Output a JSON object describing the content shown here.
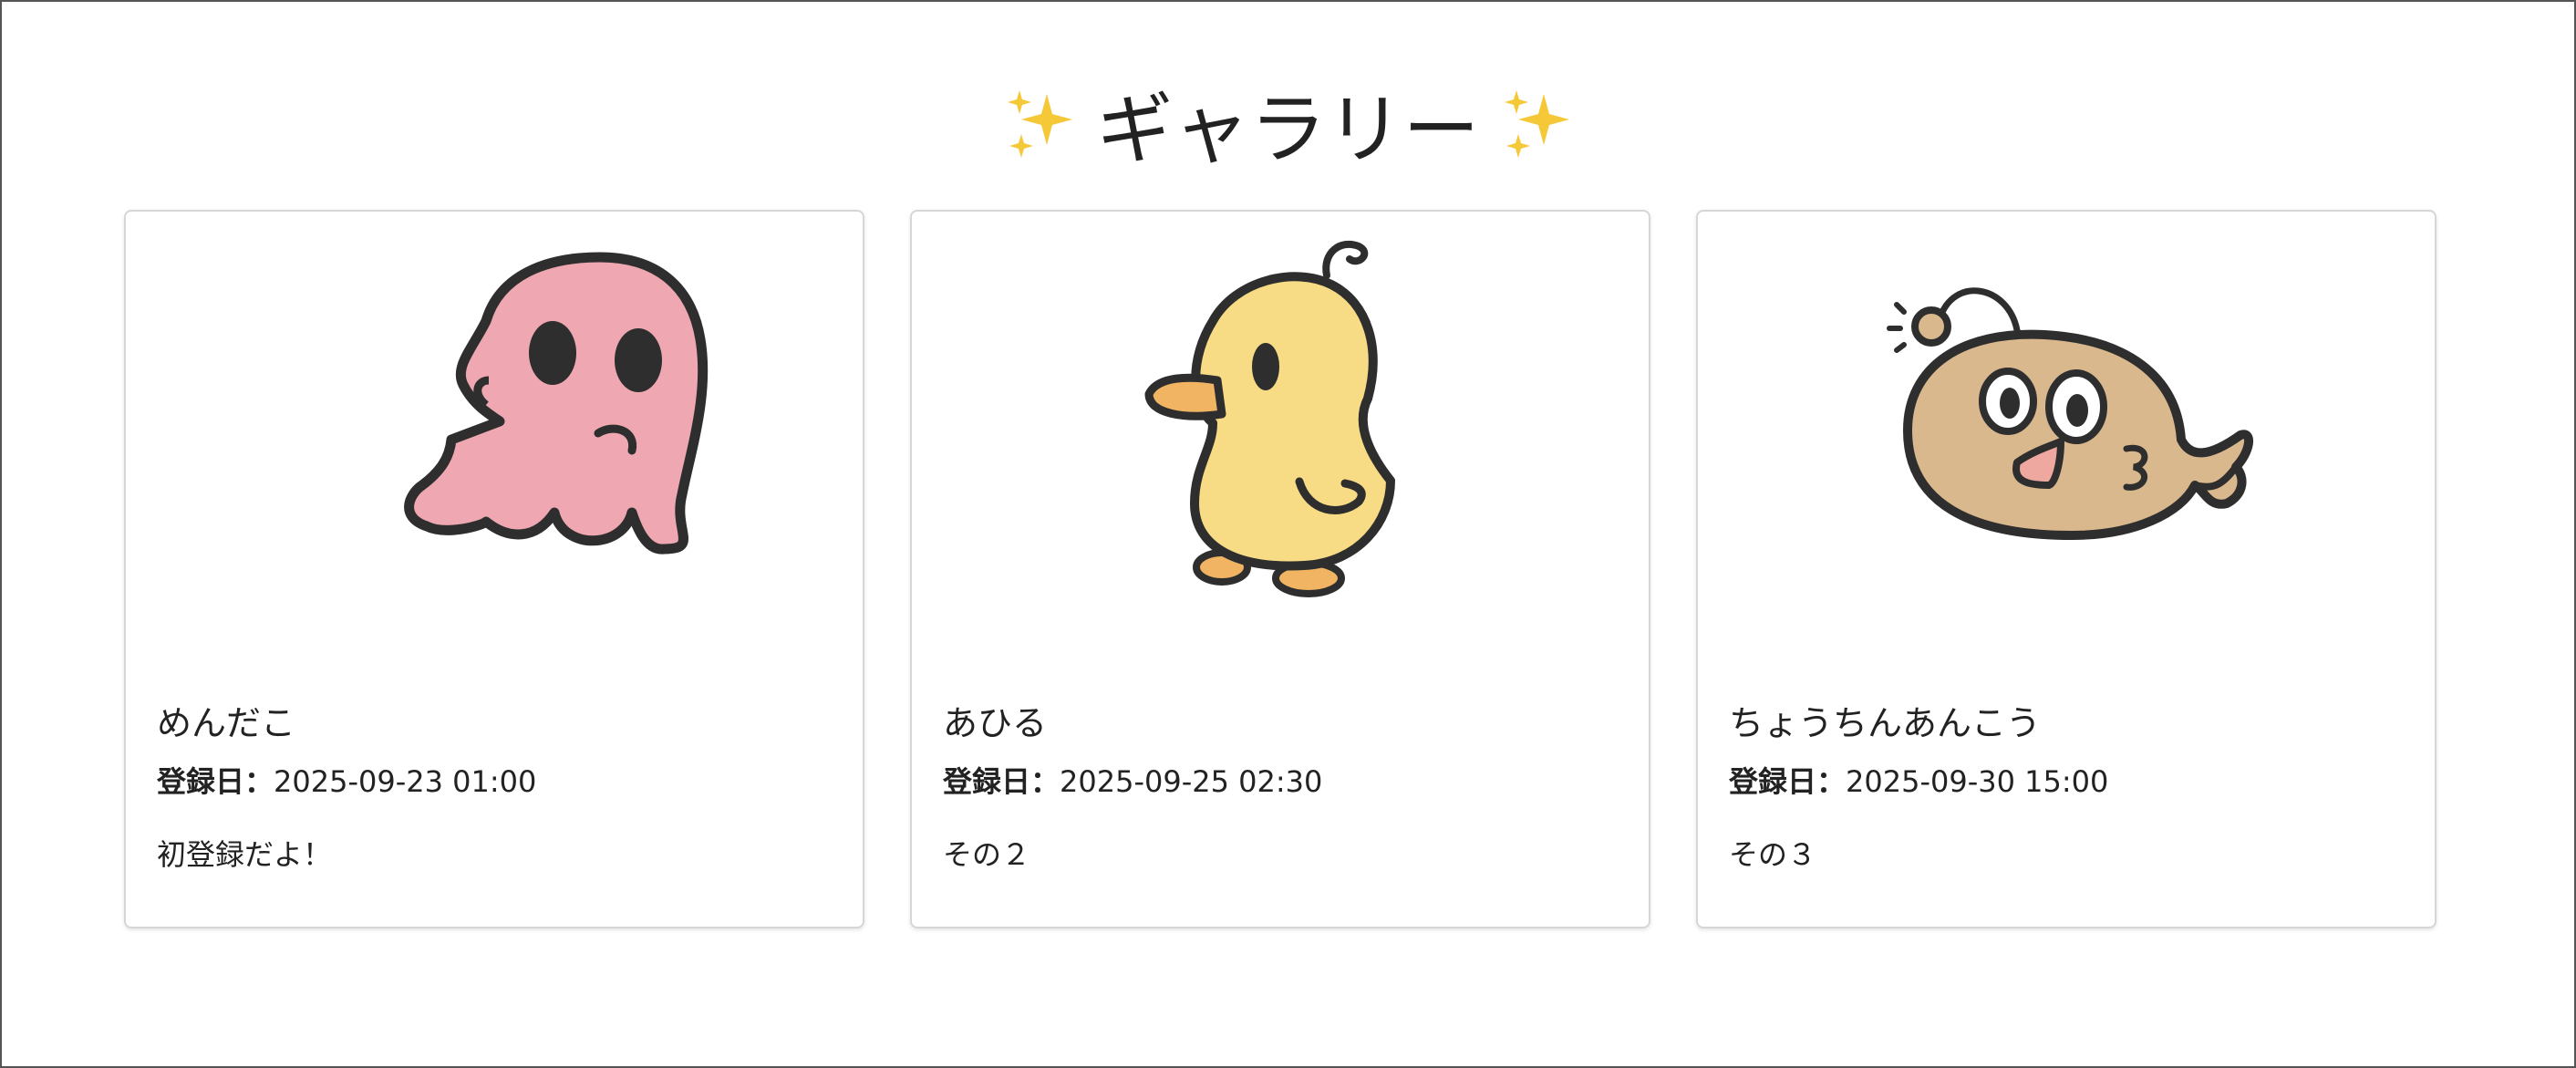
{
  "page": {
    "title": "ギャラリー"
  },
  "cards": [
    {
      "name": "めんだこ",
      "date_label": "登録日：",
      "date": "2025-09-23 01:00",
      "note": "初登録だよ！",
      "image_icon": "pink-octopus-illustration"
    },
    {
      "name": "あひる",
      "date_label": "登録日：",
      "date": "2025-09-25 02:30",
      "note": "その２",
      "image_icon": "yellow-duck-illustration"
    },
    {
      "name": "ちょうちんあんこう",
      "date_label": "登録日：",
      "date": "2025-09-30 15:00",
      "note": "その３",
      "image_icon": "anglerfish-illustration"
    }
  ],
  "colors": {
    "octopus": "#EFA8B1",
    "duck": "#F7DC85",
    "duck_beak": "#F0B463",
    "angler": "#D9B88E",
    "outline": "#2E2E2E",
    "sparkle": "#F5C838"
  }
}
